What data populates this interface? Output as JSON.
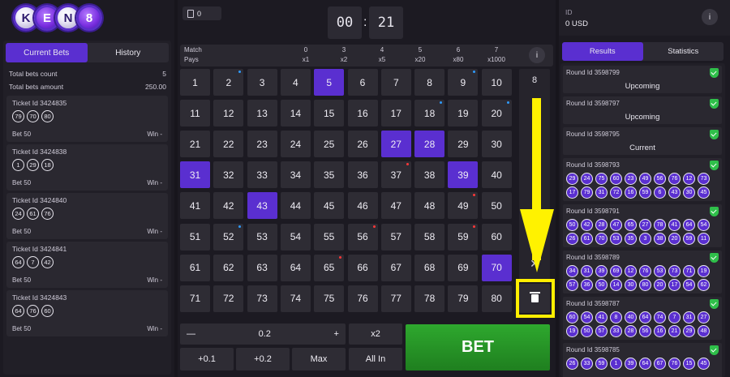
{
  "logo": {
    "letters": [
      "K",
      "E",
      "N",
      "8"
    ]
  },
  "left": {
    "tabs": [
      "Current Bets",
      "History"
    ],
    "summary": [
      {
        "label": "Total bets count",
        "value": "5"
      },
      {
        "label": "Total bets amount",
        "value": "250.00"
      }
    ],
    "tickets": [
      {
        "id": "Ticket Id 3424835",
        "nums": [
          "79",
          "70",
          "80"
        ],
        "bet": "Bet 50",
        "win": "Win -"
      },
      {
        "id": "Ticket Id 3424838",
        "nums": [
          "1",
          "29",
          "18"
        ],
        "bet": "Bet 50",
        "win": "Win -"
      },
      {
        "id": "Ticket Id 3424840",
        "nums": [
          "24",
          "61",
          "76"
        ],
        "bet": "Bet 50",
        "win": "Win -"
      },
      {
        "id": "Ticket Id 3424841",
        "nums": [
          "64",
          "7",
          "42"
        ],
        "bet": "Bet 50",
        "win": "Win -"
      },
      {
        "id": "Ticket Id 3424843",
        "nums": [
          "64",
          "76",
          "60"
        ],
        "bet": "Bet 50",
        "win": "Win -"
      }
    ]
  },
  "center": {
    "ticket_count": "0",
    "timer": {
      "min": "00",
      "sec": "21",
      "sep": ":"
    },
    "paytable": {
      "match_label": "Match",
      "pays_label": "Pays",
      "matches": [
        "0",
        "3",
        "4",
        "5",
        "6",
        "7"
      ],
      "pays": [
        "x1",
        "x2",
        "x5",
        "x20",
        "x80",
        "x1000"
      ]
    },
    "info": "i",
    "selected_count": "8",
    "clear": "✕",
    "selected": [
      5,
      27,
      28,
      31,
      39,
      43,
      70
    ],
    "blue_dots": [
      2,
      9,
      18,
      20,
      52
    ],
    "red_dots": [
      37,
      49,
      56,
      59,
      65
    ],
    "controls": {
      "minus": "—",
      "amount": "0.2",
      "plus": "+",
      "double": "x2",
      "add1": "+0.1",
      "add2": "+0.2",
      "max": "Max",
      "allin": "All In"
    },
    "bet": "BET"
  },
  "account": {
    "id_label": "ID",
    "balance": "0 USD",
    "info": "i"
  },
  "right": {
    "tabs": [
      "Results",
      "Statistics"
    ],
    "rounds": [
      {
        "id": "Round Id 3598799",
        "status": "Upcoming",
        "balls": []
      },
      {
        "id": "Round Id 3598797",
        "status": "Upcoming",
        "balls": []
      },
      {
        "id": "Round Id 3598795",
        "status": "Current",
        "balls": []
      },
      {
        "id": "Round Id 3598793",
        "status": "",
        "balls": [
          "29",
          "24",
          "75",
          "60",
          "23",
          "49",
          "56",
          "76",
          "12",
          "73",
          "17",
          "79",
          "31",
          "72",
          "16",
          "59",
          "6",
          "43",
          "30",
          "45"
        ]
      },
      {
        "id": "Round Id 3598791",
        "status": "",
        "balls": [
          "50",
          "42",
          "28",
          "47",
          "65",
          "27",
          "78",
          "41",
          "64",
          "54",
          "26",
          "61",
          "70",
          "53",
          "35",
          "3",
          "38",
          "20",
          "59",
          "11"
        ]
      },
      {
        "id": "Round Id 3598789",
        "status": "",
        "balls": [
          "34",
          "31",
          "39",
          "69",
          "12",
          "76",
          "53",
          "73",
          "71",
          "19",
          "57",
          "36",
          "50",
          "14",
          "30",
          "80",
          "20",
          "17",
          "54",
          "62"
        ]
      },
      {
        "id": "Round Id 3598787",
        "status": "",
        "balls": [
          "60",
          "54",
          "41",
          "8",
          "40",
          "64",
          "74",
          "7",
          "31",
          "27",
          "19",
          "50",
          "57",
          "33",
          "28",
          "56",
          "16",
          "21",
          "29",
          "48"
        ]
      },
      {
        "id": "Round Id 3598785",
        "status": "",
        "balls": [
          "26",
          "33",
          "59",
          "1",
          "39",
          "64",
          "67",
          "76",
          "15",
          "45"
        ]
      }
    ]
  }
}
